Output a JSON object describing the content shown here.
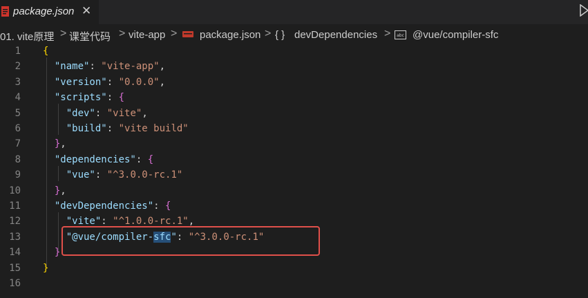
{
  "tab": {
    "title": "package.json",
    "close": "✕",
    "icon": "json-file-icon"
  },
  "breadcrumb": [
    {
      "label": "01. vite原理"
    },
    {
      "label": "课堂代码"
    },
    {
      "label": "vite-app"
    },
    {
      "label": "package.json"
    },
    {
      "label": "devDependencies"
    },
    {
      "label": "@vue/compiler-sfc"
    }
  ],
  "breadcrumb_sep": ">",
  "editor": {
    "line_numbers": [
      "1",
      "2",
      "3",
      "4",
      "5",
      "6",
      "7",
      "8",
      "9",
      "10",
      "11",
      "12",
      "13",
      "14",
      "15",
      "16"
    ],
    "lines": [
      [
        {
          "t": "{",
          "c": "b1"
        }
      ],
      [
        {
          "t": "  "
        },
        {
          "t": "\"name\"",
          "c": "k"
        },
        {
          "t": ": "
        },
        {
          "t": "\"vite-app\"",
          "c": "s"
        },
        {
          "t": ","
        }
      ],
      [
        {
          "t": "  "
        },
        {
          "t": "\"version\"",
          "c": "k"
        },
        {
          "t": ": "
        },
        {
          "t": "\"0.0.0\"",
          "c": "s"
        },
        {
          "t": ","
        }
      ],
      [
        {
          "t": "  "
        },
        {
          "t": "\"scripts\"",
          "c": "k"
        },
        {
          "t": ": "
        },
        {
          "t": "{",
          "c": "b2"
        }
      ],
      [
        {
          "t": "    "
        },
        {
          "t": "\"dev\"",
          "c": "k"
        },
        {
          "t": ": "
        },
        {
          "t": "\"vite\"",
          "c": "s"
        },
        {
          "t": ","
        }
      ],
      [
        {
          "t": "    "
        },
        {
          "t": "\"build\"",
          "c": "k"
        },
        {
          "t": ": "
        },
        {
          "t": "\"vite build\"",
          "c": "s"
        }
      ],
      [
        {
          "t": "  "
        },
        {
          "t": "}",
          "c": "b2"
        },
        {
          "t": ","
        }
      ],
      [
        {
          "t": "  "
        },
        {
          "t": "\"dependencies\"",
          "c": "k"
        },
        {
          "t": ": "
        },
        {
          "t": "{",
          "c": "b2"
        }
      ],
      [
        {
          "t": "    "
        },
        {
          "t": "\"vue\"",
          "c": "k"
        },
        {
          "t": ": "
        },
        {
          "t": "\"^3.0.0-rc.1\"",
          "c": "s"
        }
      ],
      [
        {
          "t": "  "
        },
        {
          "t": "}",
          "c": "b2"
        },
        {
          "t": ","
        }
      ],
      [
        {
          "t": "  "
        },
        {
          "t": "\"devDependencies\"",
          "c": "k"
        },
        {
          "t": ": "
        },
        {
          "t": "{",
          "c": "b2"
        }
      ],
      [
        {
          "t": "    "
        },
        {
          "t": "\"vite\"",
          "c": "k"
        },
        {
          "t": ": "
        },
        {
          "t": "\"^1.0.0-rc.1\"",
          "c": "s"
        },
        {
          "t": ","
        }
      ],
      [
        {
          "t": "    "
        },
        {
          "t": "\"@vue/compiler-",
          "c": "k"
        },
        {
          "t": "sfc",
          "c": "k hl"
        },
        {
          "t": "\"",
          "c": "k"
        },
        {
          "t": ": "
        },
        {
          "t": "\"^3.0.0-rc.1\"",
          "c": "s"
        }
      ],
      [
        {
          "t": "  "
        },
        {
          "t": "}",
          "c": "b2"
        }
      ],
      [
        {
          "t": "}",
          "c": "b1"
        }
      ],
      []
    ]
  },
  "colors": {
    "background": "#1e1e1e",
    "key": "#9cdcfe",
    "string": "#ce9178",
    "annotation_box": "#e0504a"
  }
}
